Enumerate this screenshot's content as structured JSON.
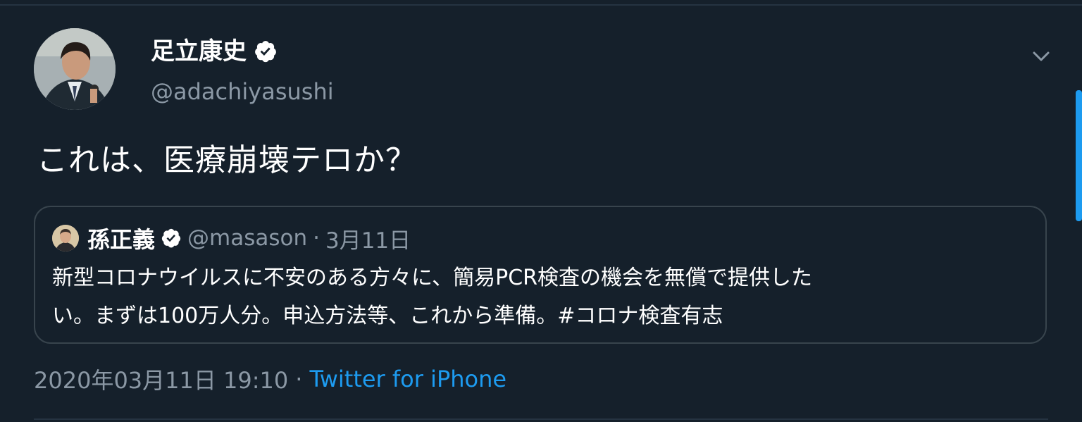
{
  "tweet": {
    "author": {
      "name": "足立康史",
      "handle": "@adachiyasushi",
      "verified": true,
      "avatar_icon": "avatar-photo"
    },
    "menu_icon": "chevron-down-icon",
    "text": "これは、医療崩壊テロか？",
    "quoted": {
      "name": "孫正義",
      "handle": "@masason",
      "separator": "·",
      "date": "3月11日",
      "verified": true,
      "text_lines": [
        "新型コロナウイルスに不安のある方々に、簡易PCR検査の機会を無償で提供した",
        "い。まずは100万人分。申込方法等、これから準備。#コロナ検査有志"
      ]
    },
    "timestamp": "2020年03月11日 19:10",
    "separator": "·",
    "client": "Twitter for iPhone"
  },
  "colors": {
    "background": "#15202b",
    "text_primary": "#ffffff",
    "text_secondary": "#8b98a5",
    "accent": "#1d9bf0",
    "border": "#38444d"
  }
}
